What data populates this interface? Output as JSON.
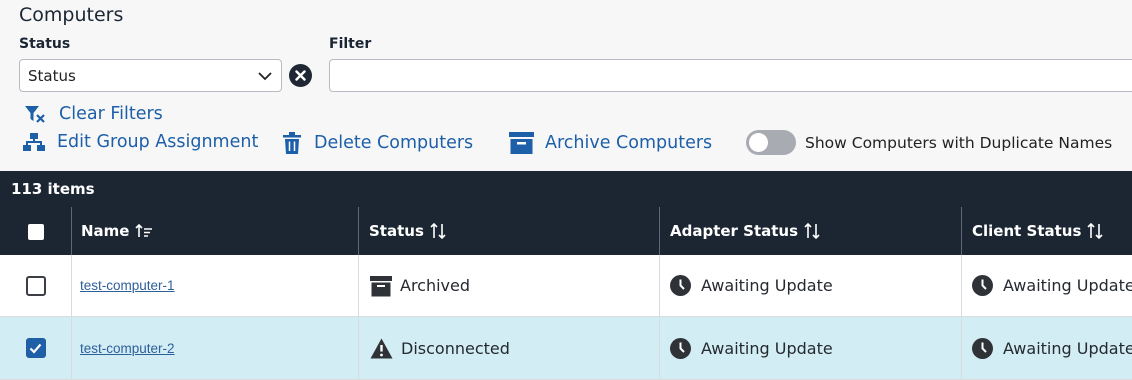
{
  "page": {
    "title": "Computers"
  },
  "filters": {
    "status_label": "Status",
    "status_value": "Status",
    "filter_label": "Filter",
    "filter_value": "",
    "filter_placeholder": ""
  },
  "actions": {
    "clear_filters": "Clear Filters",
    "edit_group": "Edit Group Assignment",
    "delete": "Delete Computers",
    "archive": "Archive Computers",
    "duplicate_toggle_label": "Show Computers with Duplicate Names",
    "duplicate_toggle_on": false
  },
  "grid": {
    "item_count": "113 items",
    "columns": {
      "name": "Name",
      "status": "Status",
      "adapter_status": "Adapter Status",
      "client_status": "Client Status"
    },
    "rows": [
      {
        "checked": false,
        "name": "test-computer-1",
        "status": "Archived",
        "status_icon": "archive-icon",
        "adapter_status": "Awaiting Update",
        "client_status": "Awaiting Update"
      },
      {
        "checked": true,
        "name": "test-computer-2",
        "status": "Disconnected",
        "status_icon": "warning-icon",
        "adapter_status": "Awaiting Update",
        "client_status": "Awaiting Update"
      }
    ]
  },
  "colors": {
    "accent": "#1d5fa8",
    "header_bg": "#1c2633",
    "selected_row": "#d2edf4"
  }
}
